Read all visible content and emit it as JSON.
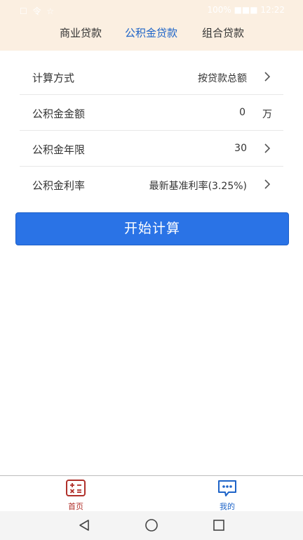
{
  "status_bar": {
    "left_icons": "☐ 令 ☆",
    "right_text": "100% ■■■ 12:22"
  },
  "tabs": [
    {
      "label": "商业贷款",
      "active": false
    },
    {
      "label": "公积金贷款",
      "active": true
    },
    {
      "label": "组合贷款",
      "active": false
    }
  ],
  "form": {
    "method": {
      "label": "计算方式",
      "value": "按贷款总额"
    },
    "amount": {
      "label": "公积金金额",
      "value": "0",
      "unit": "万"
    },
    "years": {
      "label": "公积金年限",
      "value": "30"
    },
    "rate": {
      "label": "公积金利率",
      "value": "最新基准利率(3.25%)"
    }
  },
  "calc_button": {
    "label": "开始计算"
  },
  "bottom_nav": {
    "home": {
      "label": "首页",
      "icon": "calculator-icon",
      "color": "#b0302a"
    },
    "mine": {
      "label": "我的",
      "icon": "chat-bubble-icon",
      "color": "#1e64c8"
    }
  },
  "colors": {
    "header_bg": "#fbefe1",
    "accent": "#2a73e6",
    "active_tab": "#1e64c8"
  }
}
